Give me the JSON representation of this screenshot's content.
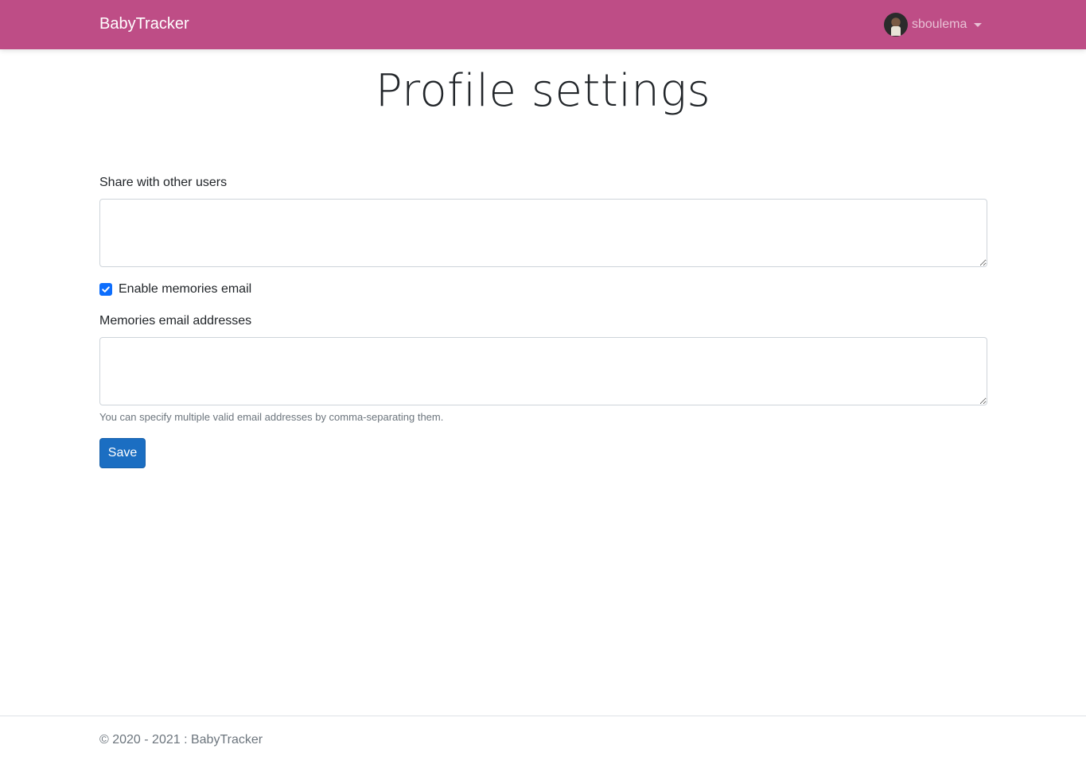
{
  "app": {
    "brand": "BabyTracker",
    "accent_color": "#be4d86"
  },
  "user_menu": {
    "username": "sboulema",
    "avatar_icon": "user-avatar",
    "caret_icon": "chevron-down-icon"
  },
  "page": {
    "title": "Profile settings"
  },
  "form": {
    "share_label": "Share with other users",
    "share_value": "",
    "memories_checkbox_label": "Enable memories email",
    "memories_checkbox_checked": true,
    "memories_addresses_label": "Memories email addresses",
    "memories_addresses_value": "",
    "memories_help": "You can specify multiple valid email addresses by comma-separating them.",
    "save_label": "Save",
    "primary_color": "#1b6ec2"
  },
  "footer": {
    "text": "© 2020 - 2021 : BabyTracker"
  }
}
